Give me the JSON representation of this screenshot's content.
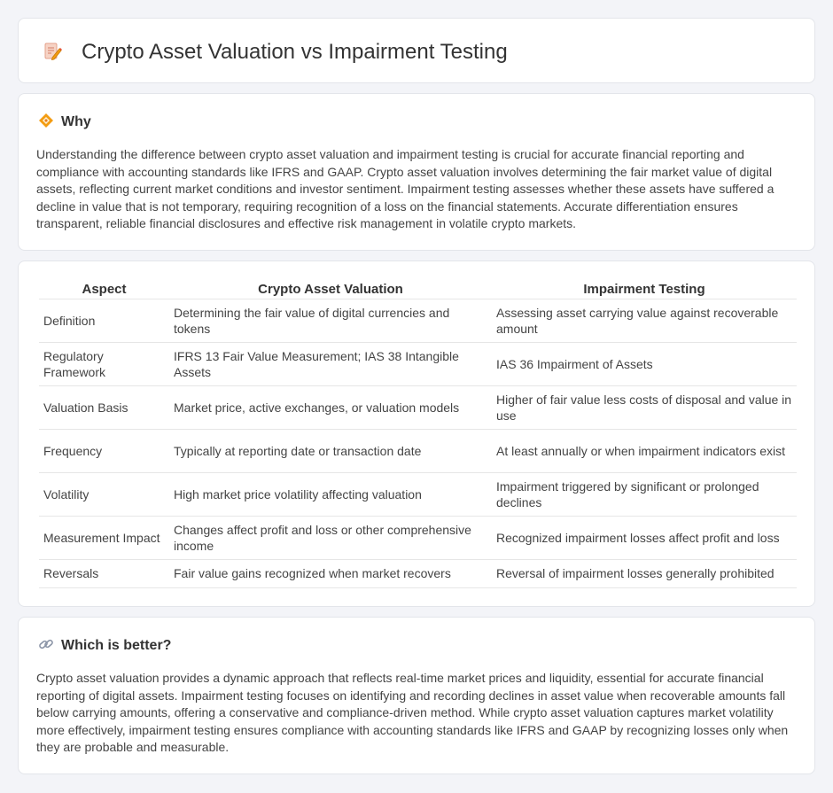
{
  "header": {
    "title": "Crypto Asset Valuation vs Impairment Testing",
    "icon": "document-edit-icon"
  },
  "why": {
    "icon": "diamond-icon",
    "title": "Why",
    "body": "Understanding the difference between crypto asset valuation and impairment testing is crucial for accurate financial reporting and compliance with accounting standards like IFRS and GAAP. Crypto asset valuation involves determining the fair market value of digital assets, reflecting current market conditions and investor sentiment. Impairment testing assesses whether these assets have suffered a decline in value that is not temporary, requiring recognition of a loss on the financial statements. Accurate differentiation ensures transparent, reliable financial disclosures and effective risk management in volatile crypto markets."
  },
  "comparison": {
    "headers": [
      "Aspect",
      "Crypto Asset Valuation",
      "Impairment Testing"
    ],
    "rows": [
      [
        "Definition",
        "Determining the fair value of digital currencies and tokens",
        "Assessing asset carrying value against recoverable amount"
      ],
      [
        "Regulatory Framework",
        "IFRS 13 Fair Value Measurement; IAS 38 Intangible Assets",
        "IAS 36 Impairment of Assets"
      ],
      [
        "Valuation Basis",
        "Market price, active exchanges, or valuation models",
        "Higher of fair value less costs of disposal and value in use"
      ],
      [
        "Frequency",
        "Typically at reporting date or transaction date",
        "At least annually or when impairment indicators exist"
      ],
      [
        "Volatility",
        "High market price volatility affecting valuation",
        "Impairment triggered by significant or prolonged declines"
      ],
      [
        "Measurement Impact",
        "Changes affect profit and loss or other comprehensive income",
        "Recognized impairment losses affect profit and loss"
      ],
      [
        "Reversals",
        "Fair value gains recognized when market recovers",
        "Reversal of impairment losses generally prohibited"
      ]
    ]
  },
  "better": {
    "icon": "link-icon",
    "title": "Which is better?",
    "body": "Crypto asset valuation provides a dynamic approach that reflects real-time market prices and liquidity, essential for accurate financial reporting of digital assets. Impairment testing focuses on identifying and recording declines in asset value when recoverable amounts fall below carrying amounts, offering a conservative and compliance-driven method. While crypto asset valuation captures market volatility more effectively, impairment testing ensures compliance with accounting standards like IFRS and GAAP by recognizing losses only when they are probable and measurable."
  },
  "colors": {
    "background": "#f3f4f8",
    "card": "#ffffff",
    "border": "#e3e5ea",
    "accent_orange": "#f39c12"
  }
}
